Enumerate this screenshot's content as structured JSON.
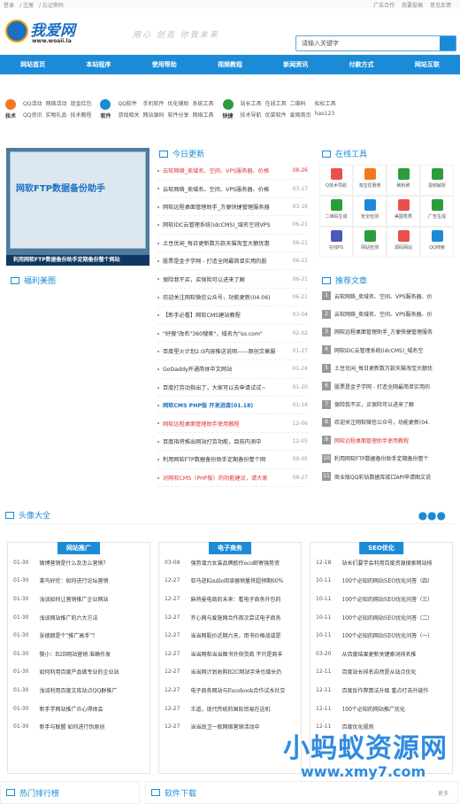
{
  "topbar": {
    "left": [
      "登录",
      "注册",
      "忘记密码"
    ],
    "right": [
      "广告合作",
      "我要投稿",
      "意见反馈"
    ]
  },
  "logo": {
    "name": "我爱网",
    "url": "www.woaii.la"
  },
  "slogan": "用心 创造 你我未来",
  "search": {
    "placeholder": "请输入关键字"
  },
  "nav": [
    "网站首页",
    "本站程序",
    "使用帮助",
    "视频教程",
    "新闻资讯",
    "付款方式",
    "网站互联"
  ],
  "quick": [
    {
      "label": "技术",
      "color": "#f07820",
      "links": [
        "QQ活动",
        "网络活动",
        "现金红包",
        "QQ资讯",
        "实物礼品",
        "技术教程"
      ]
    },
    {
      "label": "软件",
      "color": "#1b8bd8",
      "links": [
        "QQ软件",
        "手机软件",
        "优化辅助",
        "系统工具",
        "游戏相关",
        "网站源码",
        "软件分享",
        "网络工具"
      ]
    },
    {
      "label": "快捷",
      "color": "#2a9d3c",
      "links": [
        "站长工具",
        "在线工具",
        "二维码",
        "松松工具",
        "技术导航",
        "优菜软件",
        "爱网首页",
        "hao123"
      ]
    }
  ],
  "slide": {
    "shot_title": "网软FTP数据备份助手",
    "caption": "利用网软FTP数据备份助手定期备份整个网站"
  },
  "sections": {
    "today": "今日更新",
    "tools": "在线工具",
    "welfare": "福利美图",
    "recommend": "推荐文章",
    "avatar": "头像大全",
    "hot": "热门排行榜",
    "download": "软件下载",
    "more": "更多"
  },
  "news": [
    {
      "t": "云软网络_卖域名、空间、VPS服务器、价格",
      "d": "08-26",
      "red": true
    },
    {
      "t": "云软网络_卖域名、空间、VPS服务器、价格",
      "d": "03-17"
    },
    {
      "t": "网软远程桌面管理助手_方便快捷管理服务器",
      "d": "03-16"
    },
    {
      "t": "网软IDC云管理系统(idcCMS)_域名空间VPS",
      "d": "06-21"
    },
    {
      "t": "土豆优闲_每日更新数万款天猫淘宝大额优惠",
      "d": "06-21"
    },
    {
      "t": "股票是金子学网 - 打造全网最简单实用的股",
      "d": "06-21"
    },
    {
      "t": "保险我不买，买保险可以进来了解",
      "d": "06-21"
    },
    {
      "t": "欢迎关注网软微信公众号，功能更新(04.06)",
      "d": "06-21"
    },
    {
      "t": "【新手必看】网软CMS建站教程",
      "d": "03-04"
    },
    {
      "t": "\"好搜\"改名\"360搜索\"，域名为\"so.com\"",
      "d": "02-02"
    },
    {
      "t": "百度星火计划2.0内容推送说明——原创文章服",
      "d": "01-27"
    },
    {
      "t": "GoDaddy开通简体中文网站",
      "d": "01-24"
    },
    {
      "t": "百度打劳动指出了，大家可以去申请试试~",
      "d": "01-20"
    },
    {
      "t": "网软CMS PHP版 开发进度(01.18)",
      "d": "01-18",
      "blue": true
    },
    {
      "t": "网软远程桌面管理助手使用教程",
      "d": "12-06",
      "red": true
    },
    {
      "t": "百度指将推出网站打劳功能，目前内测中",
      "d": "12-05"
    },
    {
      "t": "利用网软FTP数据备份助手定期备份整个网",
      "d": "09-05"
    },
    {
      "t": "对网软CMS（PHP版）的功能建议，请大家",
      "d": "08-27",
      "red": true
    }
  ],
  "tools": [
    {
      "n": "Q技术导航",
      "c": "#e94f4f"
    },
    {
      "n": "淘宝优惠券",
      "c": "#f07820"
    },
    {
      "n": "刷粉刷",
      "c": "#2a9d3c"
    },
    {
      "n": "视频解析",
      "c": "#2a9d3c"
    },
    {
      "n": "二维码生成",
      "c": "#2a9d3c"
    },
    {
      "n": "安全检测",
      "c": "#1b8bd8"
    },
    {
      "n": "美图秀秀",
      "c": "#e94f4f"
    },
    {
      "n": "广告生成",
      "c": "#2a9d3c"
    },
    {
      "n": "在线PS",
      "c": "#4a5ab8"
    },
    {
      "n": "网站检测",
      "c": "#2a9d3c"
    },
    {
      "n": "源码网站",
      "c": "#e94f4f"
    },
    {
      "n": "QQ搜索",
      "c": "#1b8bd8"
    }
  ],
  "recommend": [
    "云软网络_卖域名、空间、VPS服务器、价",
    "云软网络_卖域名、空间、VPS服务器、价",
    "网软远程桌面管理助手_方便快捷管理服务",
    "网软IDC云管理系统(idcCMS)_域名空",
    "土豆优闲_每日更新数万款天猫淘宝大额优",
    "股票是金子学网 - 打造全网最简单实用的",
    "保险我不买，买保险可以进来了解",
    "欢迎关注网软微信公众号，功能更新(04.",
    "网软远程桌面管理助手使用教程",
    "利用网软FTP数据备份助手定期备份整个",
    "商业版QQ彩钻数据库接口API申请图文说"
  ],
  "columns": [
    {
      "tab": "网站推广",
      "rows": [
        {
          "d": "01-30",
          "t": "微博营销是什么及怎么营销？"
        },
        {
          "d": "01-30",
          "t": "莱鸟好伦：如何进行论坛营销"
        },
        {
          "d": "01-30",
          "t": "浅谈如何让营销推广企业网站"
        },
        {
          "d": "01-30",
          "t": "浅谈网站推广的六大方法"
        },
        {
          "d": "01-30",
          "t": "张德朗是个\"推广高手\"？"
        },
        {
          "d": "01-30",
          "t": "樊小：B2B网站营销 准确作发"
        },
        {
          "d": "01-30",
          "t": "如何利用百度产品做专业的企业站"
        },
        {
          "d": "01-30",
          "t": "浅谈利用百度文库站点QQ群推广"
        },
        {
          "d": "01-30",
          "t": "新手学网站推广の心得体会"
        },
        {
          "d": "01-30",
          "t": "新手与联盟 如何进行伪原创"
        }
      ]
    },
    {
      "tab": "电子商务",
      "rows": [
        {
          "d": "03-08",
          "t": "强势潜力女装品牌欧伶eco邮寄强势资"
        },
        {
          "d": "12-27",
          "t": "亚马逊Kindle阅读器销量将超预期60%"
        },
        {
          "d": "12-27",
          "t": "麻将曼电商的未来：看电子商务外包的"
        },
        {
          "d": "12-27",
          "t": "齐心网与爱施网合作首次尝试电子商务"
        },
        {
          "d": "12-27",
          "t": "当当网股价近期六天，用书价格战或是"
        },
        {
          "d": "12-27",
          "t": "当当网和当当图书外供货商 不只是商丰"
        },
        {
          "d": "12-27",
          "t": "当当网计划收购B2C网站宇来也增长仍"
        },
        {
          "d": "12-27",
          "t": "电子商务网站与Facebook合作试水社交"
        },
        {
          "d": "12-27",
          "t": "王道，现代传统的国际贸易在这机"
        },
        {
          "d": "12-27",
          "t": "当当改卫一般网络营销活动中"
        }
      ]
    },
    {
      "tab": "SEO优化",
      "rows": [
        {
          "d": "12-18",
          "t": "站长们要学会利用百度资源搜索网站排"
        },
        {
          "d": "10-11",
          "t": "100个必知的网站SEO优化问答（四）"
        },
        {
          "d": "10-11",
          "t": "100个必知的网站SEO优化问答（三）"
        },
        {
          "d": "10-11",
          "t": "100个必知的网站SEO优化问答（二）"
        },
        {
          "d": "10-11",
          "t": "100个必知的网站SEO优化问答（一）"
        },
        {
          "d": "03-20",
          "t": "从百度结果更新关键索词排名推"
        },
        {
          "d": "12-11",
          "t": "百度站长排名自然是从站点优化"
        },
        {
          "d": "12-11",
          "t": "百度反作弊算法升级 重点打击外链作"
        },
        {
          "d": "12-11",
          "t": "100个必知的网站推广优化"
        },
        {
          "d": "12-11",
          "t": "百度优化规则"
        }
      ]
    }
  ],
  "watermark": {
    "line1": "小蚂蚁资源网",
    "line2": "www.xmy7.com"
  }
}
